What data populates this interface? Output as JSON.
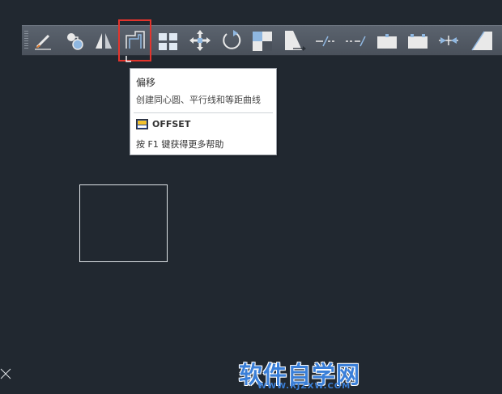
{
  "toolbar": {
    "tools": [
      {
        "name": "match-properties-icon"
      },
      {
        "name": "copy-icon"
      },
      {
        "name": "mirror-icon"
      },
      {
        "name": "offset-icon",
        "highlighted": true
      },
      {
        "name": "array-icon"
      },
      {
        "name": "move-icon"
      },
      {
        "name": "rotate-icon"
      },
      {
        "name": "scale-icon"
      },
      {
        "name": "stretch-icon"
      },
      {
        "name": "trim-icon"
      },
      {
        "name": "extend-icon"
      },
      {
        "name": "break-at-point-icon"
      },
      {
        "name": "break-icon"
      },
      {
        "name": "join-icon"
      },
      {
        "name": "chamfer-icon"
      }
    ],
    "highlight_color": "#e3342c"
  },
  "tooltip": {
    "title": "偏移",
    "description": "创建同心圆、平行线和等距曲线",
    "command": "OFFSET",
    "help": "按 F1 键获得更多帮助"
  },
  "canvas": {
    "background": "#212830",
    "shape": "rectangle"
  },
  "watermark": {
    "main": "软件自学网",
    "sub": "WWW.RJZXW.COM",
    "color": "#3a7fd8"
  }
}
